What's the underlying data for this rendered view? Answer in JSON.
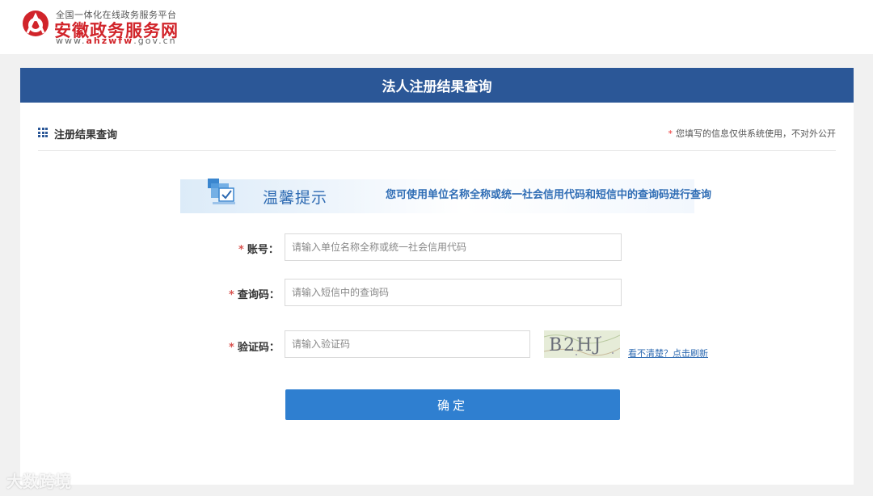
{
  "header": {
    "logo_subtitle": "全国一体化在线政务服务平台",
    "logo_title": "安徽政务服务网",
    "logo_url_prefix": "www.",
    "logo_url_brand": "ahzwfw",
    "logo_url_suffix": ".gov.cn",
    "brand_color": "#d1242a"
  },
  "page": {
    "title": "法人注册结果查询",
    "bar_color": "#2b5797"
  },
  "section": {
    "title": "注册结果查询",
    "note_star": "*",
    "note": "您填写的信息仅供系统使用，不对外公开"
  },
  "tip": {
    "title": "温馨提示",
    "text": "您可使用单位名称全称或统一社会信用代码和短信中的查询码进行查询"
  },
  "form": {
    "required_mark": "*",
    "account_label": "账号：",
    "account_placeholder": "请输入单位名称全称或统一社会信用代码",
    "query_code_label": "查询码：",
    "query_code_placeholder": "请输入短信中的查询码",
    "captcha_label": "验证码：",
    "captcha_placeholder": "请输入验证码",
    "captcha_text": "B2HJ",
    "refresh_link": "看不清楚？点击刷新",
    "submit_label": "确定",
    "accent_color": "#2f7fd0"
  },
  "watermark": {
    "text": "大数跨境"
  }
}
